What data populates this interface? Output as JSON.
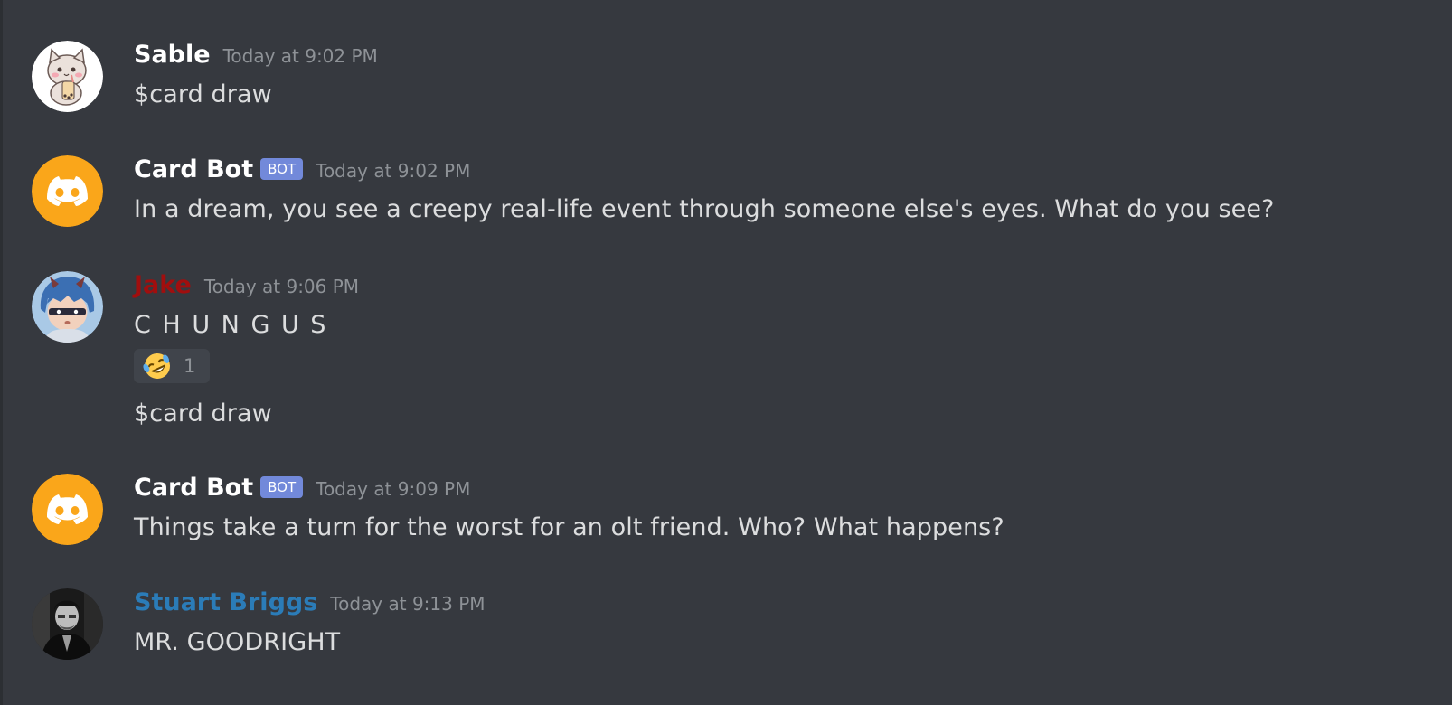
{
  "colors": {
    "background": "#36393f",
    "bot_tag": "#7289da",
    "bot_avatar": "#faa61a",
    "jake_name": "#a10e0e",
    "stuart_name": "#2b7cb8",
    "timestamp": "#8e9297",
    "text": "#dcddde"
  },
  "messages": [
    {
      "author": "Sable",
      "timestamp": "Today at 9:02 PM",
      "content": "$card draw",
      "avatar": "cat-avatar"
    },
    {
      "author": "Card Bot",
      "bot_tag": "BOT",
      "timestamp": "Today at 9:02 PM",
      "content": "In a dream, you see a creepy real-life event through someone else's eyes.  What do you see?",
      "avatar": "discord-icon"
    },
    {
      "author": "Jake",
      "timestamp": "Today at 9:06 PM",
      "content": "C H U N G U S",
      "reaction": {
        "emoji": "rofl-emoji",
        "count": "1"
      },
      "followup": "$card draw",
      "avatar": "anime-avatar"
    },
    {
      "author": "Card Bot",
      "bot_tag": "BOT",
      "timestamp": "Today at 9:09 PM",
      "content": "Things take a turn for the worst for an olt friend.  Who?  What happens?",
      "avatar": "discord-icon"
    },
    {
      "author": "Stuart Briggs",
      "timestamp": "Today at 9:13 PM",
      "content": "MR. GOODRIGHT",
      "avatar": "photo-avatar"
    }
  ]
}
